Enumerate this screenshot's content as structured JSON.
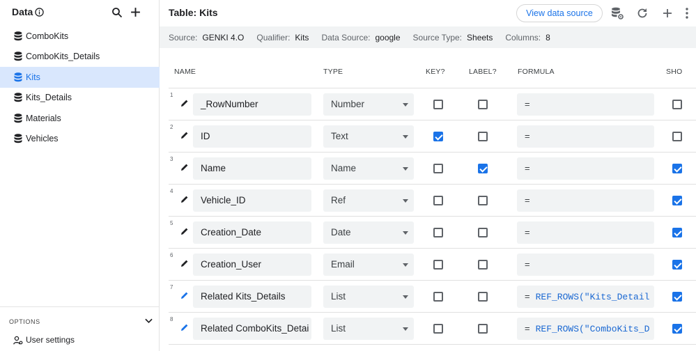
{
  "sidebar": {
    "title": "Data",
    "items": [
      {
        "label": "ComboKits",
        "active": false
      },
      {
        "label": "ComboKits_Details",
        "active": false
      },
      {
        "label": "Kits",
        "active": true
      },
      {
        "label": "Kits_Details",
        "active": false
      },
      {
        "label": "Materials",
        "active": false
      },
      {
        "label": "Vehicles",
        "active": false
      }
    ],
    "options_label": "OPTIONS",
    "user_settings_label": "User settings"
  },
  "topbar": {
    "title": "Table: Kits",
    "view_button_label": "View data source"
  },
  "info": {
    "source_key": "Source:",
    "source_val": "GENKI 4.O",
    "qualifier_key": "Qualifier:",
    "qualifier_val": "Kits",
    "datasource_key": "Data Source:",
    "datasource_val": "google",
    "sourcetype_key": "Source Type:",
    "sourcetype_val": "Sheets",
    "columns_key": "Columns:",
    "columns_val": "8"
  },
  "columns": {
    "name": "NAME",
    "type": "TYPE",
    "key": "KEY?",
    "label": "LABEL?",
    "formula": "FORMULA",
    "show": "SHO"
  },
  "rows": [
    {
      "num": "1",
      "name": "_RowNumber",
      "type": "Number",
      "key": false,
      "label": false,
      "eq": "=",
      "formula": "",
      "show": false,
      "pencil": "dark"
    },
    {
      "num": "2",
      "name": "ID",
      "type": "Text",
      "key": true,
      "label": false,
      "eq": "=",
      "formula": "",
      "show": false,
      "pencil": "dark"
    },
    {
      "num": "3",
      "name": "Name",
      "type": "Name",
      "key": false,
      "label": true,
      "eq": "=",
      "formula": "",
      "show": true,
      "pencil": "dark"
    },
    {
      "num": "4",
      "name": "Vehicle_ID",
      "type": "Ref",
      "key": false,
      "label": false,
      "eq": "=",
      "formula": "",
      "show": true,
      "pencil": "dark"
    },
    {
      "num": "5",
      "name": "Creation_Date",
      "type": "Date",
      "key": false,
      "label": false,
      "eq": "=",
      "formula": "",
      "show": true,
      "pencil": "dark"
    },
    {
      "num": "6",
      "name": "Creation_User",
      "type": "Email",
      "key": false,
      "label": false,
      "eq": "=",
      "formula": "",
      "show": true,
      "pencil": "dark"
    },
    {
      "num": "7",
      "name": "Related Kits_Details",
      "type": "List",
      "key": false,
      "label": false,
      "eq": "=",
      "formula": "REF_ROWS(\"Kits_Detail",
      "show": true,
      "pencil": "blue"
    },
    {
      "num": "8",
      "name": "Related ComboKits_Detai",
      "type": "List",
      "key": false,
      "label": false,
      "eq": "=",
      "formula": "REF_ROWS(\"ComboKits_D",
      "show": true,
      "pencil": "blue"
    }
  ],
  "colors": {
    "accent": "#1a73e8",
    "active_bg": "#d9e7fd",
    "field_bg": "#f1f3f4"
  }
}
